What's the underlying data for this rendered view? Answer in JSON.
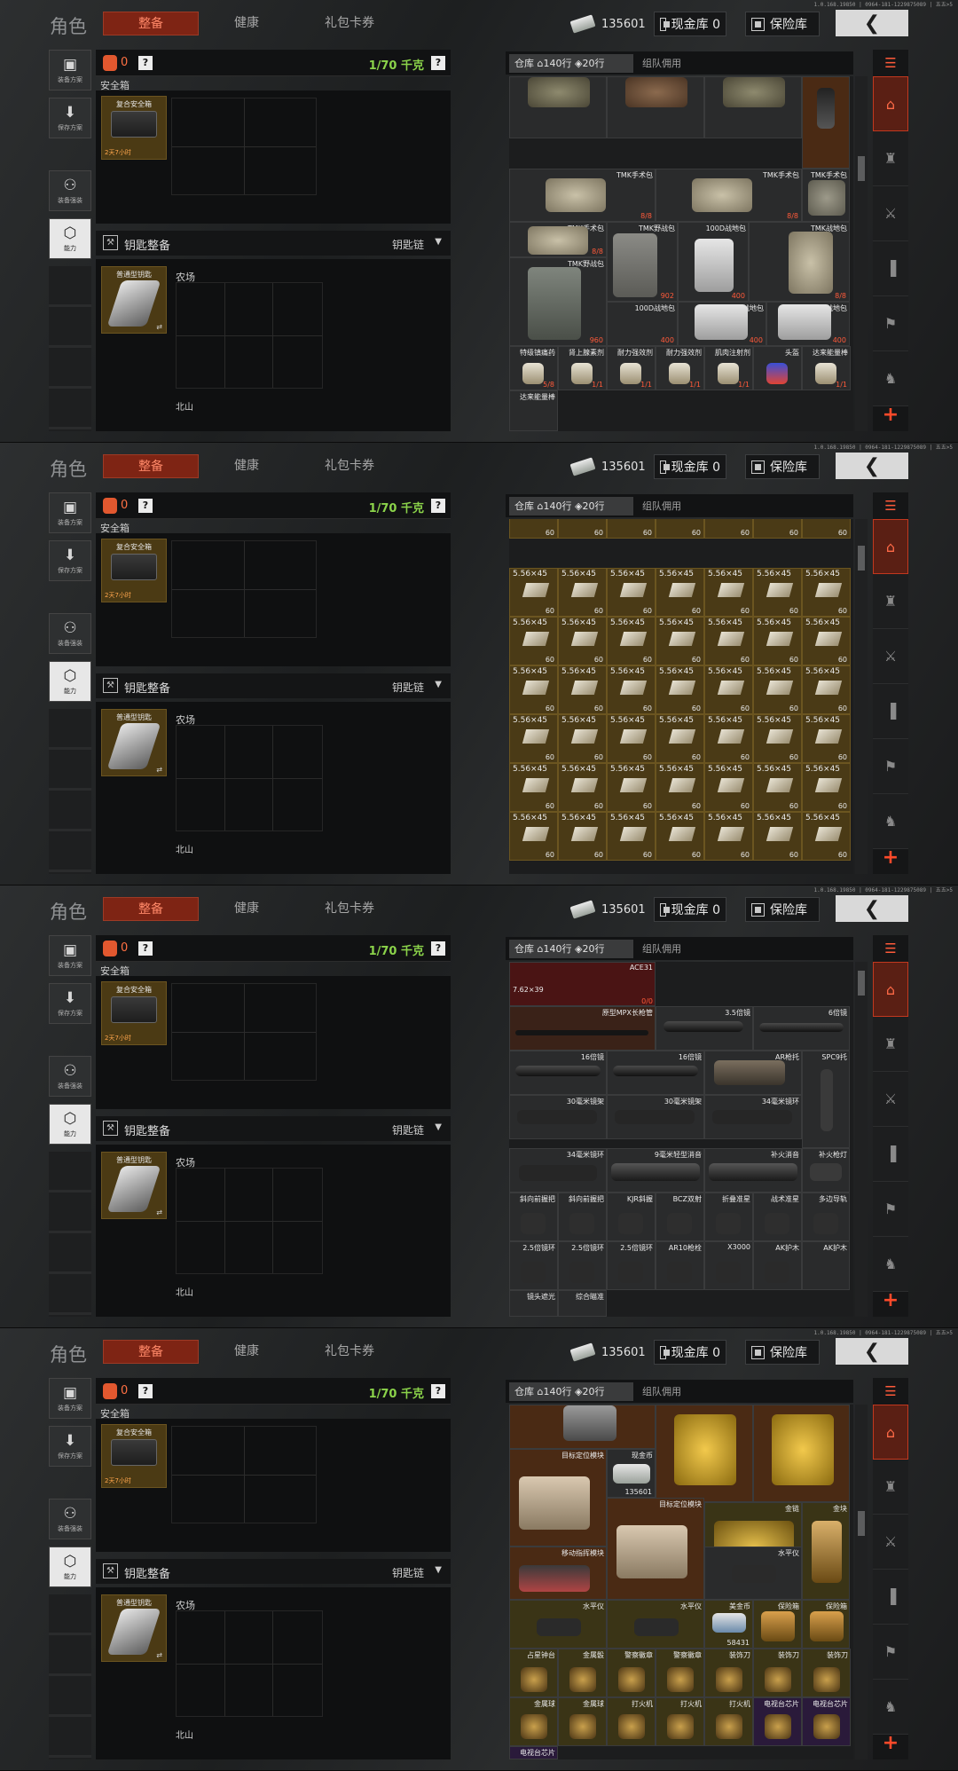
{
  "version_text": "1.0.168.19850 | 0964-181-1229875089 | 五五>5",
  "topbar": {
    "title": "角色",
    "tabs": [
      "整备",
      "健康",
      "礼包卡券"
    ],
    "money": "135601",
    "cash_label": "现金库 0",
    "safe_label": "保险库"
  },
  "sidebar": [
    "装备方案",
    "保存方案",
    "装备强装",
    "能力"
  ],
  "equip": {
    "count": "0",
    "weight": "1/70 千克",
    "safe_label": "安全箱",
    "safe_item": "复合安全箱",
    "safe_time": "2天7小时",
    "key_label": "钥匙整备",
    "key_chain": "钥匙链",
    "key_item": "普通型钥匙",
    "map_farm": "农场",
    "map_north": "北山"
  },
  "inventory": {
    "tab_label": "仓库",
    "rows": "140行",
    "cols": "20行",
    "team": "组队佣用"
  },
  "colors": {
    "accent": "#c2381f",
    "weight_green": "#8bd34a",
    "item_gold": "#4b3a14"
  },
  "panels": [
    {
      "cells": [
        {
          "name": "",
          "count": ""
        },
        {
          "name": "",
          "count": ""
        },
        {
          "name": "",
          "count": ""
        },
        {
          "name": "",
          "count": ""
        },
        {
          "name": "TMK手术包",
          "count": "8/8"
        },
        {
          "name": "TMK手术包",
          "count": "8/8"
        },
        {
          "name": "TMK手术包",
          "count": ""
        },
        {
          "name": "TMK手术包",
          "count": "8/8"
        },
        {
          "name": "TMK野战包",
          "count": "902"
        },
        {
          "name": "100D战地包",
          "count": "400"
        },
        {
          "name": "TMK战地包",
          "count": "8/8"
        },
        {
          "name": "TMK野战包",
          "count": "960"
        },
        {
          "name": "100D战地包",
          "count": "400"
        },
        {
          "name": "100D战地包",
          "count": "400"
        },
        {
          "name": "100D战地包",
          "count": "400"
        },
        {
          "name": "特级镇痛药",
          "count": "5/8"
        },
        {
          "name": "肾上腺素剂",
          "count": "1/1"
        },
        {
          "name": "耐力强效剂",
          "count": "1/1"
        },
        {
          "name": "耐力强效剂",
          "count": "1/1"
        },
        {
          "name": "肌肉注射剂",
          "count": "1/1"
        },
        {
          "name": "头盔",
          "count": ""
        },
        {
          "name": "达来能量棒",
          "count": "1/1"
        },
        {
          "name": "达来能量棒",
          "count": ""
        }
      ]
    },
    {
      "ammo_label": "5.56×45",
      "ammo_count": "60"
    },
    {
      "cells": [
        {
          "name": "ACE31",
          "count": ""
        },
        {
          "name": "7.62×39",
          "count": "0/0"
        },
        {
          "name": "原型MPX长枪管",
          "count": ""
        },
        {
          "name": "3.5倍镜",
          "count": ""
        },
        {
          "name": "6倍镜",
          "count": ""
        },
        {
          "name": "16倍镜",
          "count": ""
        },
        {
          "name": "16倍镜",
          "count": ""
        },
        {
          "name": "AR枪托",
          "count": ""
        },
        {
          "name": "SPC9托",
          "count": ""
        },
        {
          "name": "30毫米镜架",
          "count": ""
        },
        {
          "name": "30毫米镜架",
          "count": ""
        },
        {
          "name": "34毫米镜环",
          "count": ""
        },
        {
          "name": "34毫米镜环",
          "count": ""
        },
        {
          "name": "9毫米轻型消音",
          "count": ""
        },
        {
          "name": "补火消音",
          "count": ""
        },
        {
          "name": "补火枪灯",
          "count": ""
        },
        {
          "name": "斜向前握把",
          "count": ""
        },
        {
          "name": "斜向前握把",
          "count": ""
        },
        {
          "name": "KJR斜握",
          "count": ""
        },
        {
          "name": "BCZ双射",
          "count": ""
        },
        {
          "name": "折叠准星",
          "count": ""
        },
        {
          "name": "战术准星",
          "count": ""
        },
        {
          "name": "多边导轨",
          "count": ""
        },
        {
          "name": "2.5倍镜环",
          "count": ""
        },
        {
          "name": "2.5倍镜环",
          "count": ""
        },
        {
          "name": "2.5倍镜环",
          "count": ""
        },
        {
          "name": "AR10枪栓",
          "count": ""
        },
        {
          "name": "X3000",
          "count": ""
        },
        {
          "name": "AK护木",
          "count": ""
        },
        {
          "name": "镜头遮光",
          "count": ""
        },
        {
          "name": "综合瞄准",
          "count": ""
        }
      ]
    },
    {
      "cells": [
        {
          "name": "",
          "count": ""
        },
        {
          "name": "",
          "count": ""
        },
        {
          "name": "",
          "count": ""
        },
        {
          "name": "目标定位模块",
          "count": ""
        },
        {
          "name": "现金币",
          "count": "135601"
        },
        {
          "name": "",
          "count": ""
        },
        {
          "name": "",
          "count": ""
        },
        {
          "name": "目标定位模块",
          "count": ""
        },
        {
          "name": "金链",
          "count": ""
        },
        {
          "name": "金块",
          "count": ""
        },
        {
          "name": "移动指挥模块",
          "count": ""
        },
        {
          "name": "水平仪",
          "count": ""
        },
        {
          "name": "水平仪",
          "count": ""
        },
        {
          "name": "水平仪",
          "count": ""
        },
        {
          "name": "美金币",
          "count": "58431"
        },
        {
          "name": "保险箱",
          "count": ""
        },
        {
          "name": "保险箱",
          "count": ""
        },
        {
          "name": "占星钟台",
          "count": ""
        },
        {
          "name": "金属骰",
          "count": ""
        },
        {
          "name": "警察徽章",
          "count": ""
        },
        {
          "name": "警察徽章",
          "count": ""
        },
        {
          "name": "装饰刀",
          "count": ""
        },
        {
          "name": "装饰刀",
          "count": ""
        },
        {
          "name": "装饰刀",
          "count": ""
        },
        {
          "name": "金属球",
          "count": ""
        },
        {
          "name": "金属球",
          "count": ""
        },
        {
          "name": "打火机",
          "count": ""
        },
        {
          "name": "打火机",
          "count": ""
        },
        {
          "name": "打火机",
          "count": ""
        },
        {
          "name": "电视台芯片",
          "count": ""
        },
        {
          "name": "电视台芯片",
          "count": ""
        },
        {
          "name": "电视台芯片",
          "count": ""
        }
      ]
    }
  ]
}
